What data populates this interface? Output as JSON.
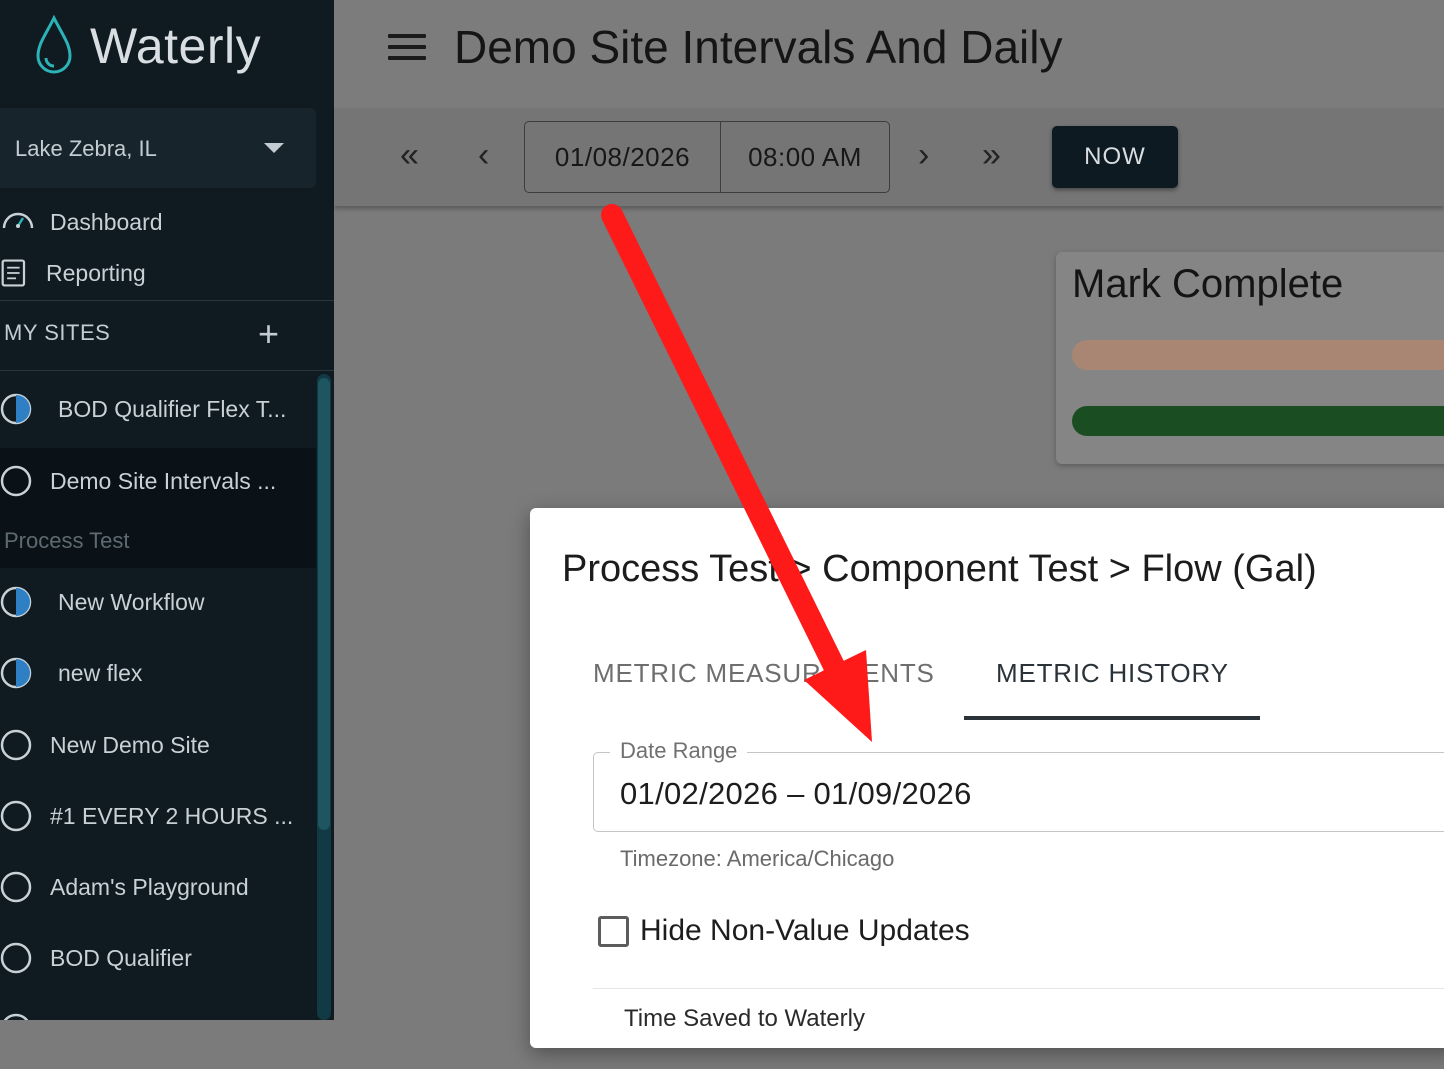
{
  "app": {
    "brand_name": "Waterly",
    "site_selector": "Lake Zebra, IL"
  },
  "sidebar": {
    "nav": [
      {
        "label": "Dashboard",
        "icon": "gauge-icon"
      },
      {
        "label": "Reporting",
        "icon": "report-icon"
      }
    ],
    "my_sites_label": "MY SITES",
    "add_icon": "+",
    "sites_top": [
      {
        "label": "BOD Qualifier Flex T...",
        "icon": "half-circle-icon"
      },
      {
        "label": "Demo Site Intervals ...",
        "icon": "circle-icon"
      }
    ],
    "group_label": "Process Test",
    "sites": [
      {
        "label": "New Workflow",
        "icon": "half-circle-icon"
      },
      {
        "label": "new flex",
        "icon": "half-circle-icon"
      },
      {
        "label": "New Demo Site",
        "icon": "circle-icon"
      },
      {
        "label": "#1 EVERY 2 HOURS ...",
        "icon": "circle-icon"
      },
      {
        "label": "Adam's Playground",
        "icon": "circle-icon"
      },
      {
        "label": "BOD Qualifier",
        "icon": "circle-icon"
      }
    ]
  },
  "header": {
    "title": "Demo Site Intervals And Daily"
  },
  "timebar": {
    "first_icon": "«",
    "prev_icon": "‹",
    "date": "01/08/2026",
    "time": "08:00 AM",
    "next_icon": "›",
    "last_icon": "»",
    "now_label": "NOW"
  },
  "card": {
    "title": "Mark Complete"
  },
  "dialog": {
    "title": "Process Test > Component Test > Flow (Gal)",
    "tabs": [
      {
        "label": "METRIC MEASUREMENTS",
        "active": false
      },
      {
        "label": "METRIC HISTORY",
        "active": true
      }
    ],
    "date_range_label": "Date Range",
    "date_range_value": "01/02/2026 – 01/09/2026",
    "timezone": "Timezone: America/Chicago",
    "hide_label": "Hide Non-Value Updates",
    "table_header": "Time Saved to Waterly"
  },
  "colors": {
    "sidebar_bg": "#0f1a21",
    "accent_teal": "#1d5560",
    "annotation_arrow": "#ff1a1a",
    "progress_orange": "#a98673",
    "progress_green": "#1b4d22"
  }
}
